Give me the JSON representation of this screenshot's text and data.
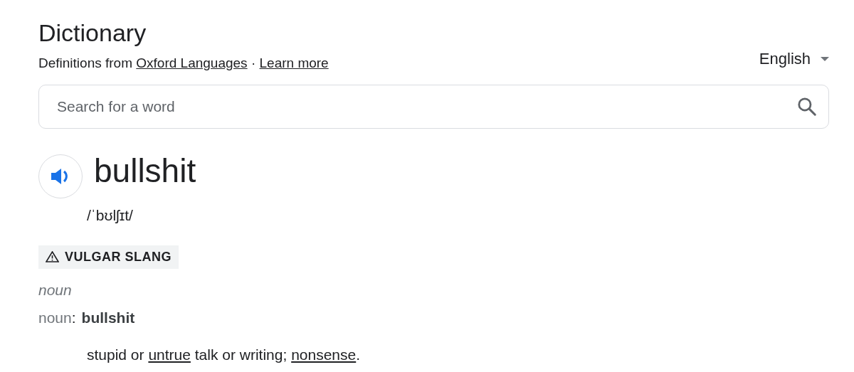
{
  "title": "Dictionary",
  "source": [
    {
      "text": "Definitions from ",
      "link": false
    },
    {
      "text": "Oxford Languages",
      "link": true
    },
    {
      "text": " · ",
      "link": false
    },
    {
      "text": "Learn more",
      "link": true
    }
  ],
  "language": {
    "value": "English"
  },
  "search": {
    "placeholder": "Search for a word"
  },
  "entry": {
    "word": "bullshit",
    "phonetic": "/ˈbʊlʃɪt/",
    "register": "VULGAR SLANG",
    "part_of_speech": "noun",
    "sense_label": "noun",
    "separator": ":",
    "headword": "bullshit",
    "definition": [
      {
        "text": "stupid or ",
        "link": false
      },
      {
        "text": "untrue",
        "link": true
      },
      {
        "text": " talk or writing; ",
        "link": false
      },
      {
        "text": "nonsense",
        "link": true
      },
      {
        "text": ".",
        "link": false
      }
    ]
  }
}
